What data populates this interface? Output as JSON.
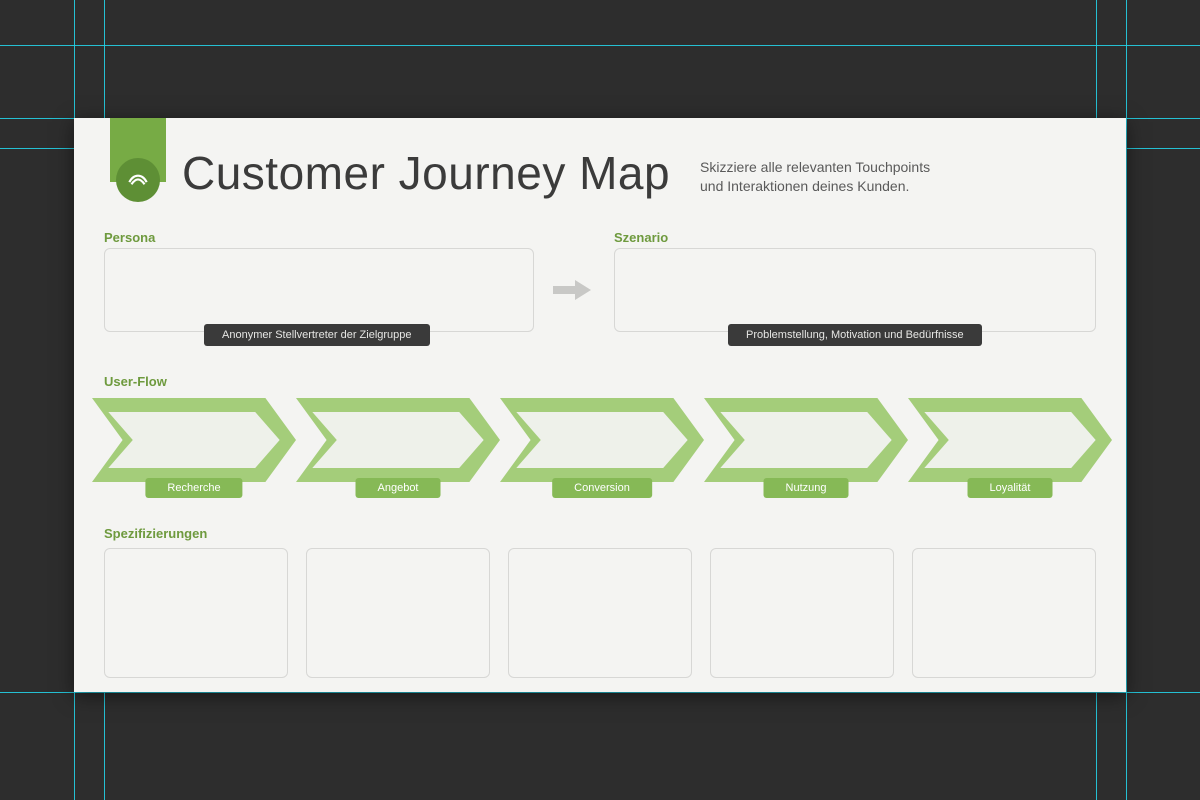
{
  "canvas": {
    "guides_h": [
      45,
      118,
      148,
      692
    ],
    "guides_v": [
      74,
      104,
      1096,
      1126
    ]
  },
  "header": {
    "title": "Customer Journey Map",
    "subtitle_line1": "Skizziere alle relevanten Touchpoints",
    "subtitle_line2": "und Interaktionen deines Kunden."
  },
  "sections": {
    "persona": {
      "label": "Persona",
      "tooltip": "Anonymer Stellvertreter der Zielgruppe"
    },
    "szenario": {
      "label": "Szenario",
      "tooltip": "Problemstellung, Motivation und Bedürfnisse"
    },
    "userflow": {
      "label": "User-Flow",
      "steps": [
        "Recherche",
        "Angebot",
        "Conversion",
        "Nutzung",
        "Loyalität"
      ]
    },
    "spezifizierungen": {
      "label": "Spezifizierungen",
      "count": 5
    }
  },
  "colors": {
    "accent": "#77ab45",
    "accent_light": "#a4cd7a",
    "dark_pill": "#3a3a3a",
    "canvas_bg": "#2d2d2d",
    "artboard_bg": "#f4f4f2"
  }
}
